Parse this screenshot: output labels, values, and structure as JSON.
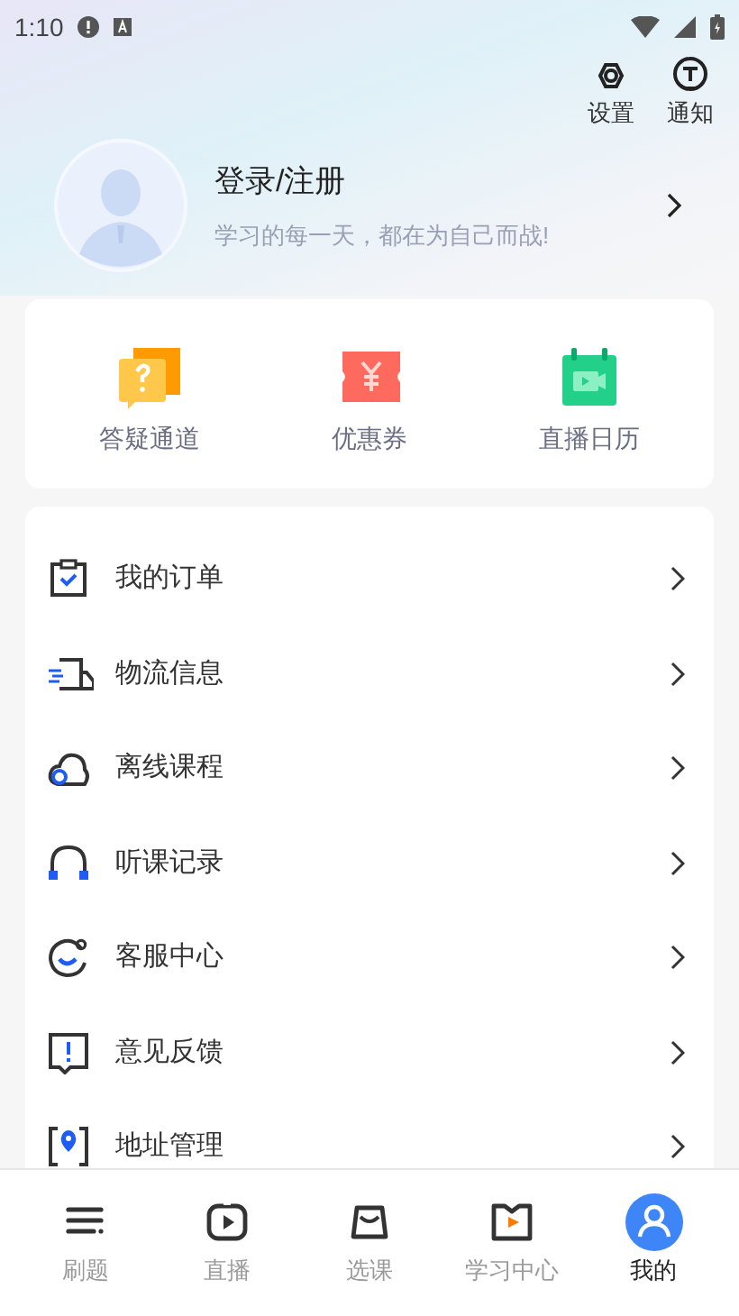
{
  "status_bar": {
    "time": "1:10"
  },
  "header": {
    "actions": [
      {
        "kind": "settings",
        "label": "设置"
      },
      {
        "kind": "notice",
        "label": "通知"
      }
    ]
  },
  "profile": {
    "title": "登录/注册",
    "subtitle": "学习的每一天，都在为自己而战!"
  },
  "shortcuts": [
    {
      "kind": "question",
      "label": "答疑通道"
    },
    {
      "kind": "coupon",
      "label": "优惠券"
    },
    {
      "kind": "calendar",
      "label": "直播日历"
    }
  ],
  "menu": [
    {
      "kind": "order",
      "label": "我的订单"
    },
    {
      "kind": "logistics",
      "label": "物流信息"
    },
    {
      "kind": "offline",
      "label": "离线课程"
    },
    {
      "kind": "history",
      "label": "听课记录"
    },
    {
      "kind": "service",
      "label": "客服中心"
    },
    {
      "kind": "feedback",
      "label": "意见反馈"
    },
    {
      "kind": "address",
      "label": "地址管理"
    }
  ],
  "tabs": [
    {
      "kind": "practice",
      "label": "刷题",
      "selected": false
    },
    {
      "kind": "live",
      "label": "直播",
      "selected": false
    },
    {
      "kind": "courses",
      "label": "选课",
      "selected": false
    },
    {
      "kind": "study",
      "label": "学习中心",
      "selected": false
    },
    {
      "kind": "me",
      "label": "我的",
      "selected": true
    }
  ]
}
